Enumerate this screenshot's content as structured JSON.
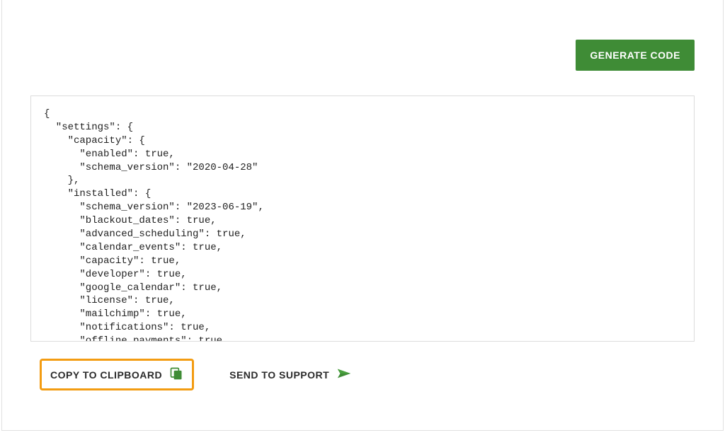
{
  "top": {
    "generate_label": "GENERATE CODE"
  },
  "code": {
    "content": "{\n  \"settings\": {\n    \"capacity\": {\n      \"enabled\": true,\n      \"schema_version\": \"2020-04-28\"\n    },\n    \"installed\": {\n      \"schema_version\": \"2023-06-19\",\n      \"blackout_dates\": true,\n      \"advanced_scheduling\": true,\n      \"calendar_events\": true,\n      \"capacity\": true,\n      \"developer\": true,\n      \"google_calendar\": true,\n      \"license\": true,\n      \"mailchimp\": true,\n      \"notifications\": true,\n      \"offline_payments\": true,\n      \"payments\": true,"
  },
  "bottom": {
    "copy_label": "COPY TO CLIPBOARD",
    "support_label": "SEND TO SUPPORT"
  },
  "colors": {
    "primary_green": "#3f8c36",
    "highlight_orange": "#f39c12",
    "icon_green": "#3f8c36"
  }
}
